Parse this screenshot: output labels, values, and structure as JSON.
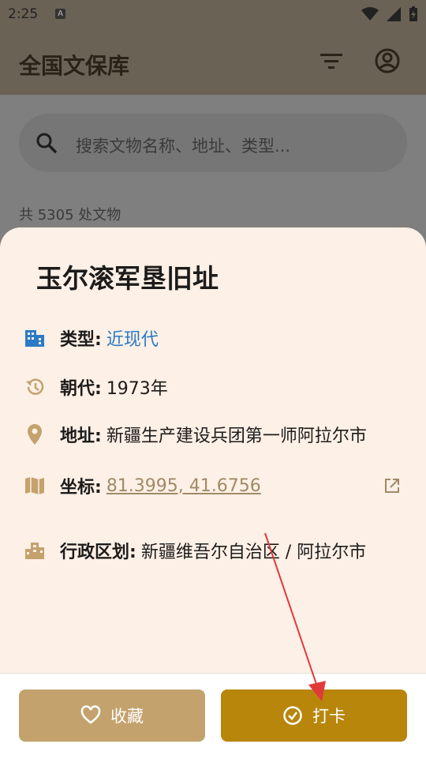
{
  "status_bar": {
    "time": "2:25",
    "notification_letter": "A"
  },
  "app_bar": {
    "title": "全国文保库"
  },
  "search": {
    "placeholder": "搜索文物名称、地址、类型..."
  },
  "list": {
    "count_text": "共 5305 处文物"
  },
  "detail": {
    "title": "玉尔滚军垦旧址",
    "rows": [
      {
        "label": "类型:",
        "value": "近现代"
      },
      {
        "label": "朝代:",
        "value": "1973年"
      },
      {
        "label": "地址:",
        "value": "新疆生产建设兵团第一师阿拉尔市"
      },
      {
        "label": "坐标:",
        "value": "81.3995, 41.6756"
      },
      {
        "label": "行政区划:",
        "value": "新疆维吾尔自治区 / 阿拉尔市"
      }
    ]
  },
  "actions": {
    "favorite_label": "收藏",
    "checkin_label": "打卡"
  },
  "colors": {
    "accent": "#b8860b",
    "favorite": "#c4a26d",
    "link": "#2a7ac7",
    "annotation_arrow": "#e03a3a"
  }
}
